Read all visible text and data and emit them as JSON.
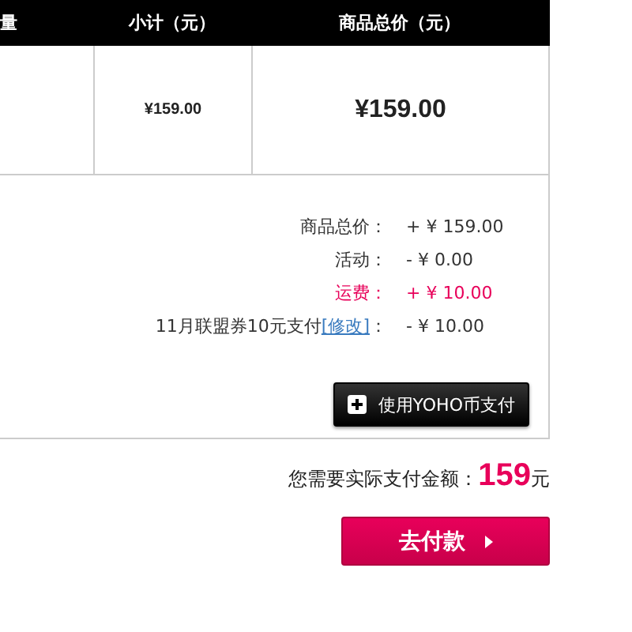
{
  "table": {
    "columns": [
      "量",
      "小计（元）",
      "商品总价（元）"
    ],
    "rows": [
      {
        "cells": [
          "",
          "¥159.00",
          "¥159.00"
        ]
      }
    ]
  },
  "summary": {
    "lines": [
      {
        "label": "商品总价：",
        "value": "+ ¥ 159.00",
        "highlight": false
      },
      {
        "label": "活动：",
        "value": "- ¥ 0.00",
        "highlight": false
      },
      {
        "label": "运费：",
        "value": "+ ¥ 10.00",
        "highlight": true
      },
      {
        "label": "11月联盟券10元支付",
        "link": "[修改]",
        "label_end": "：",
        "value": "- ¥ 10.00",
        "highlight": false
      }
    ],
    "coin_button": "使用YOHO币支付"
  },
  "total": {
    "label": "您需要实际支付金额：",
    "amount": "159",
    "unit": "元"
  },
  "pay_button": "去付款"
}
